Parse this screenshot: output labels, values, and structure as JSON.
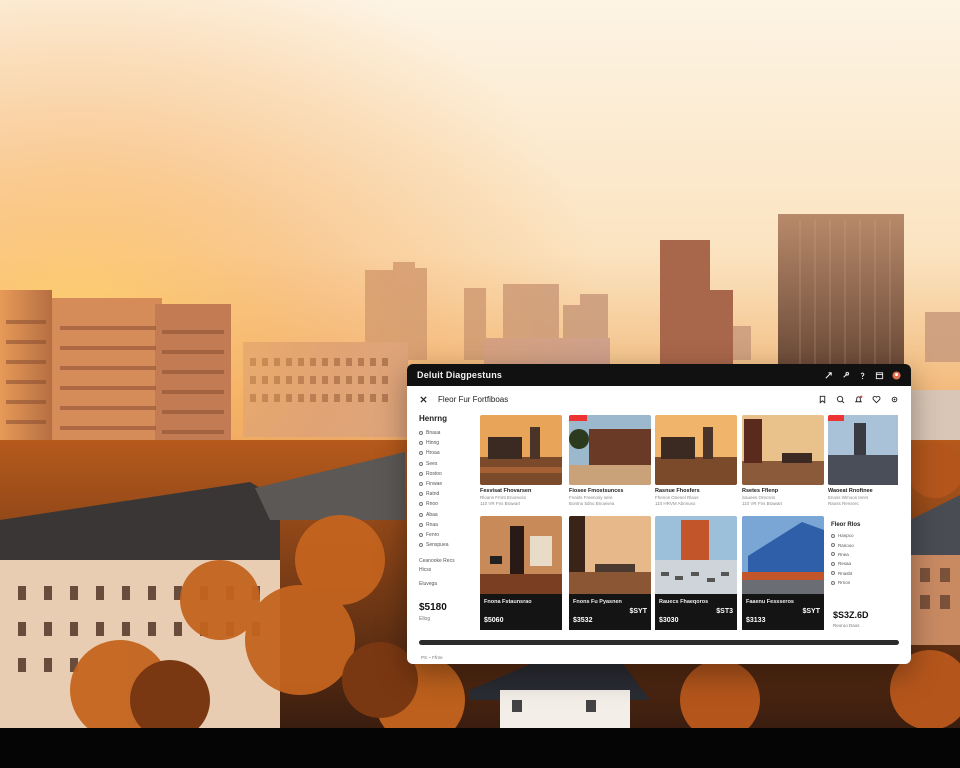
{
  "window": {
    "title": "Deluit Diagpestuns",
    "toolbar_label": "Fleor Fur Fortfiboas"
  },
  "icons": {
    "close": "close-icon",
    "share": "share-icon",
    "bookmark": "bookmark-icon",
    "notifications": "bell-icon",
    "favorite": "heart-icon",
    "settings": "gear-icon",
    "avatar_color": "#e07050"
  },
  "sidebar": {
    "heading": "Henrng",
    "items": [
      "Bnaua",
      "Hinng",
      "Hroaa",
      "Sees",
      "Rostoo",
      "Finwae",
      "Ratnd",
      "Rnoo",
      "Abaa",
      "Rnaa",
      "Fenro",
      "Senspuea"
    ],
    "extra": [
      "Ceanooke Recs",
      "Hicss",
      "Eluvega"
    ],
    "price": "$5180",
    "price_sub": "Ellog"
  },
  "cards_top": [
    {
      "title": "Fesvisat Fhovarsen",
      "meta": "Rloans Frnnt Enoreoss",
      "meta2": "110 VR  Fns Brawart"
    },
    {
      "title": "Fiosee Fmostsunces",
      "meta": "Fnasts Freenosy sere",
      "meta2": "Bontnu 5dnu Bnowvea"
    },
    {
      "title": "Rasnue Fhosfers",
      "meta": "Fhenos Onenel Rlaos",
      "meta2": "110 HRVM  Abnnuso"
    },
    {
      "title": "Rsetes Fflenp",
      "meta": "Sauees Orecsns",
      "meta2": "110 VR  Fns Brawart"
    },
    {
      "title": "Waoeat Rnoftnee",
      "meta": "Enoss Wmoos Ienrs",
      "meta2": "Raoss Rensrec"
    }
  ],
  "cards_bottom": [
    {
      "title": "Fnona Fstaunsrao",
      "price_left": "$5060",
      "price_right": ""
    },
    {
      "title": "Fnons Fu Pyasnen",
      "price_left": "$3532",
      "price_right": "$SYT"
    },
    {
      "title": "Rauecs Fhaeqoros",
      "price_left": "$3030",
      "price_right": "$ST3"
    },
    {
      "title": "Faaenu Fessseros",
      "price_left": "$3133",
      "price_right": "$SYT"
    }
  ],
  "right_panel": {
    "heading": "Fleor Rlos",
    "items": [
      "Hanpco",
      "Ranooo",
      "Rnea",
      "Resaa",
      "Rnasbt",
      "Rrnos"
    ],
    "price": "$S3Z.6D",
    "price_sub": "Reoroo Daos"
  },
  "footer": "PS  ~  Ffnre"
}
